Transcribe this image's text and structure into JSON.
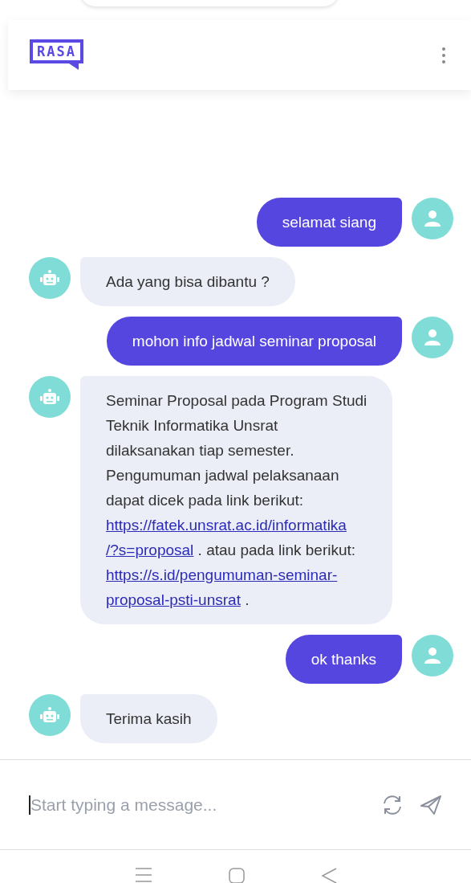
{
  "header": {
    "logo": "RASA"
  },
  "messages": [
    {
      "kind": "user",
      "lines": [
        [
          {
            "kind": "text",
            "text": "selamat siang"
          }
        ]
      ]
    },
    {
      "kind": "bot",
      "lines": [
        [
          {
            "kind": "text",
            "text": "Ada yang bisa dibantu ?"
          }
        ]
      ]
    },
    {
      "kind": "user",
      "lines": [
        [
          {
            "kind": "text",
            "text": "mohon info jadwal seminar proposal"
          }
        ]
      ]
    },
    {
      "kind": "bot",
      "lines": [
        [
          {
            "kind": "text",
            "text": "Seminar Proposal pada Program Studi"
          }
        ],
        [
          {
            "kind": "text",
            "text": "Teknik Informatika Unsrat"
          }
        ],
        [
          {
            "kind": "text",
            "text": "dilaksanakan tiap semester."
          }
        ],
        [
          {
            "kind": "text",
            "text": "Pengumuman jadwal pelaksanaan"
          }
        ],
        [
          {
            "kind": "text",
            "text": "dapat dicek pada link berikut:"
          }
        ],
        [
          {
            "kind": "link",
            "text": "https://fatek.unsrat.ac.id/informatika"
          }
        ],
        [
          {
            "kind": "link",
            "text": "/?s=proposal"
          },
          {
            "kind": "text",
            "text": " . atau pada link berikut:"
          }
        ],
        [
          {
            "kind": "link",
            "text": "https://s.id/pengumuman-seminar-"
          }
        ],
        [
          {
            "kind": "link",
            "text": "proposal-psti-unsrat"
          },
          {
            "kind": "text",
            "text": " ."
          }
        ]
      ]
    },
    {
      "kind": "user",
      "lines": [
        [
          {
            "kind": "text",
            "text": "ok thanks"
          }
        ]
      ]
    },
    {
      "kind": "bot",
      "lines": [
        [
          {
            "kind": "text",
            "text": "Terima kasih"
          }
        ]
      ]
    }
  ],
  "composer": {
    "placeholder": "Start typing a message..."
  }
}
